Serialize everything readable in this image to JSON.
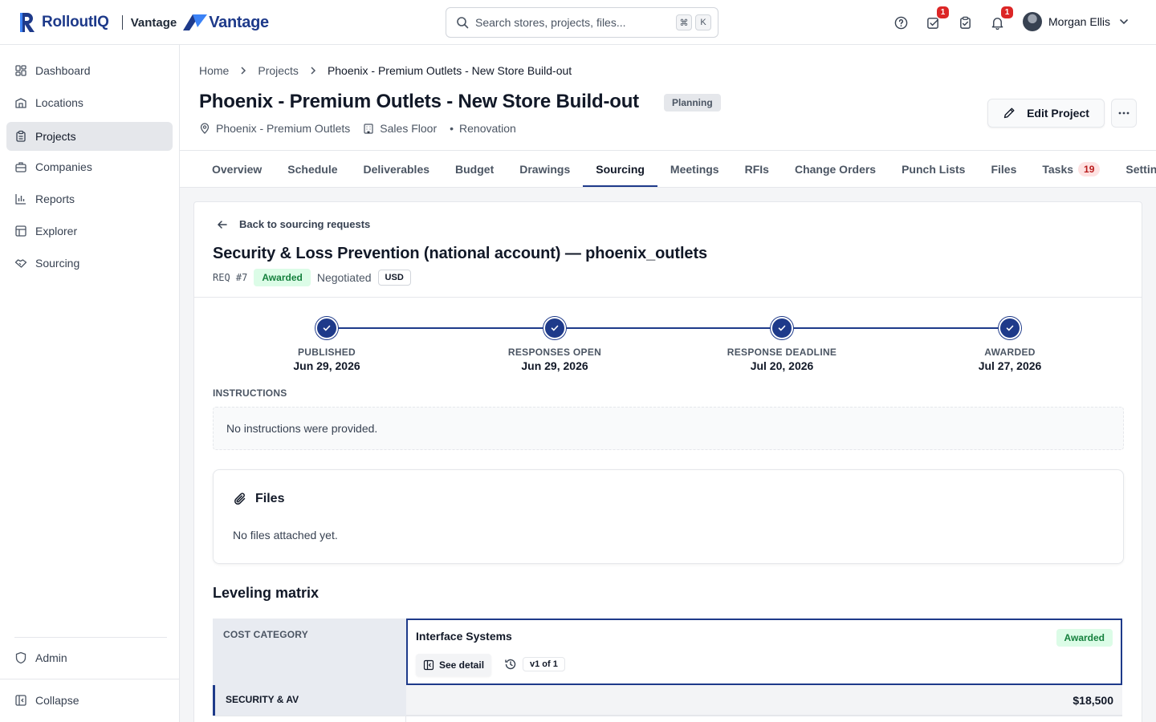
{
  "brand": {
    "name": "RolloutIQ",
    "client_label": "Vantage",
    "client_logo_text": "Vantage"
  },
  "search": {
    "placeholder": "Search stores, projects, files...",
    "shortcut_mod": "⌘",
    "shortcut_key": "K"
  },
  "header_icons": {
    "tasks_badge": "1",
    "notifications_badge": "1"
  },
  "user": {
    "name": "Morgan Ellis"
  },
  "sidebar": {
    "items": [
      {
        "label": "Dashboard",
        "icon": "dashboard-icon"
      },
      {
        "label": "Locations",
        "icon": "building-icon"
      },
      {
        "label": "Projects",
        "icon": "clipboard-icon",
        "active": true
      },
      {
        "label": "Companies",
        "icon": "briefcase-icon"
      },
      {
        "label": "Reports",
        "icon": "bar-chart-icon"
      },
      {
        "label": "Explorer",
        "icon": "table-icon"
      },
      {
        "label": "Sourcing",
        "icon": "handshake-icon"
      }
    ],
    "admin_label": "Admin",
    "collapse_label": "Collapse"
  },
  "breadcrumb": [
    "Home",
    "Projects",
    "Phoenix - Premium Outlets - New Store Build-out"
  ],
  "project": {
    "title": "Phoenix - Premium Outlets - New Store Build-out",
    "status": "Planning",
    "location": "Phoenix - Premium Outlets",
    "area": "Sales Floor",
    "type": "Renovation",
    "edit_label": "Edit Project"
  },
  "tabs": [
    "Overview",
    "Schedule",
    "Deliverables",
    "Budget",
    "Drawings",
    "Sourcing",
    "Meetings",
    "RFIs",
    "Change Orders",
    "Punch Lists",
    "Files",
    "Tasks",
    "Settings"
  ],
  "active_tab": "Sourcing",
  "tasks_count": "19",
  "request": {
    "back_label": "Back to sourcing requests",
    "title": "Security & Loss Prevention (national account) — phoenix_outlets",
    "req_id": "REQ #7",
    "status": "Awarded",
    "type": "Negotiated",
    "currency": "USD"
  },
  "timeline": [
    {
      "label": "PUBLISHED",
      "date": "Jun 29, 2026"
    },
    {
      "label": "RESPONSES OPEN",
      "date": "Jun 29, 2026"
    },
    {
      "label": "RESPONSE DEADLINE",
      "date": "Jul 20, 2026"
    },
    {
      "label": "AWARDED",
      "date": "Jul 27, 2026"
    }
  ],
  "instructions": {
    "label": "INSTRUCTIONS",
    "text": "No instructions were provided."
  },
  "files": {
    "title": "Files",
    "empty_text": "No files attached yet."
  },
  "matrix": {
    "title": "Leveling matrix",
    "column_header": "COST CATEGORY",
    "vendor": {
      "name": "Interface Systems",
      "status": "Awarded",
      "detail_label": "See detail",
      "version": "v1 of 1"
    },
    "rows": [
      {
        "category": "SECURITY & AV",
        "amount": "$18,500"
      }
    ]
  },
  "colors": {
    "brand_navy": "#1e3a8a",
    "awarded_green": "#15803d",
    "badge_red": "#dc2626"
  }
}
